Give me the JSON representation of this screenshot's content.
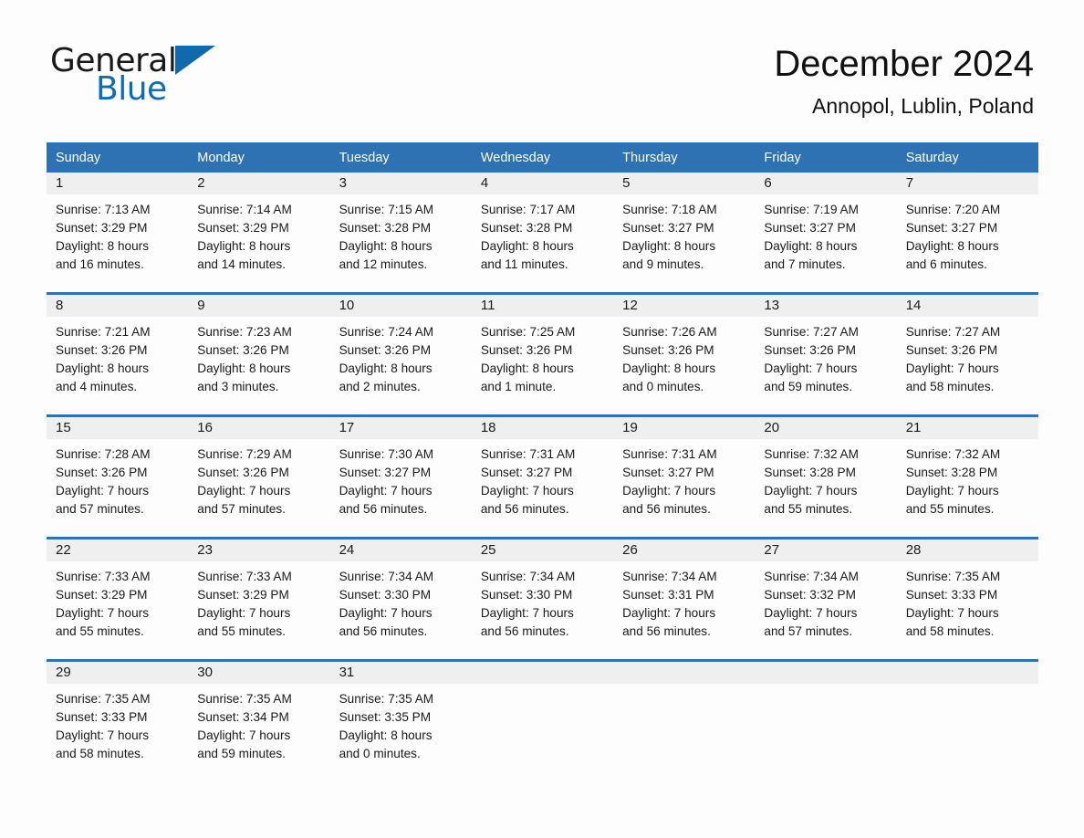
{
  "brand": {
    "word1": "General",
    "word2": "Blue",
    "triangle_color": "#1168ab",
    "blue_color": "#0e6cb6"
  },
  "header": {
    "title": "December 2024",
    "subtitle": "Annopol, Lublin, Poland"
  },
  "theme": {
    "header_blue": "#2f72b4",
    "day_band_gray": "#efefef",
    "page_bg": "#fdfdfd",
    "text": "#1a1a1a"
  },
  "weekday_headers": [
    "Sunday",
    "Monday",
    "Tuesday",
    "Wednesday",
    "Thursday",
    "Friday",
    "Saturday"
  ],
  "chart_data": {
    "type": "table",
    "title": "December 2024 Sunrise and Sunset — Annopol, Lublin, Poland",
    "columns": [
      "Sunday",
      "Monday",
      "Tuesday",
      "Wednesday",
      "Thursday",
      "Friday",
      "Saturday"
    ],
    "fields": [
      "day",
      "sunrise",
      "sunset",
      "daylight_hours",
      "daylight_minutes"
    ]
  },
  "weeks": [
    {
      "cells": [
        {
          "day": "1",
          "l1": "Sunrise: 7:13 AM",
          "l2": "Sunset: 3:29 PM",
          "l3": "Daylight: 8 hours",
          "l4": "and 16 minutes."
        },
        {
          "day": "2",
          "l1": "Sunrise: 7:14 AM",
          "l2": "Sunset: 3:29 PM",
          "l3": "Daylight: 8 hours",
          "l4": "and 14 minutes."
        },
        {
          "day": "3",
          "l1": "Sunrise: 7:15 AM",
          "l2": "Sunset: 3:28 PM",
          "l3": "Daylight: 8 hours",
          "l4": "and 12 minutes."
        },
        {
          "day": "4",
          "l1": "Sunrise: 7:17 AM",
          "l2": "Sunset: 3:28 PM",
          "l3": "Daylight: 8 hours",
          "l4": "and 11 minutes."
        },
        {
          "day": "5",
          "l1": "Sunrise: 7:18 AM",
          "l2": "Sunset: 3:27 PM",
          "l3": "Daylight: 8 hours",
          "l4": "and 9 minutes."
        },
        {
          "day": "6",
          "l1": "Sunrise: 7:19 AM",
          "l2": "Sunset: 3:27 PM",
          "l3": "Daylight: 8 hours",
          "l4": "and 7 minutes."
        },
        {
          "day": "7",
          "l1": "Sunrise: 7:20 AM",
          "l2": "Sunset: 3:27 PM",
          "l3": "Daylight: 8 hours",
          "l4": "and 6 minutes."
        }
      ]
    },
    {
      "cells": [
        {
          "day": "8",
          "l1": "Sunrise: 7:21 AM",
          "l2": "Sunset: 3:26 PM",
          "l3": "Daylight: 8 hours",
          "l4": "and 4 minutes."
        },
        {
          "day": "9",
          "l1": "Sunrise: 7:23 AM",
          "l2": "Sunset: 3:26 PM",
          "l3": "Daylight: 8 hours",
          "l4": "and 3 minutes."
        },
        {
          "day": "10",
          "l1": "Sunrise: 7:24 AM",
          "l2": "Sunset: 3:26 PM",
          "l3": "Daylight: 8 hours",
          "l4": "and 2 minutes."
        },
        {
          "day": "11",
          "l1": "Sunrise: 7:25 AM",
          "l2": "Sunset: 3:26 PM",
          "l3": "Daylight: 8 hours",
          "l4": "and 1 minute."
        },
        {
          "day": "12",
          "l1": "Sunrise: 7:26 AM",
          "l2": "Sunset: 3:26 PM",
          "l3": "Daylight: 8 hours",
          "l4": "and 0 minutes."
        },
        {
          "day": "13",
          "l1": "Sunrise: 7:27 AM",
          "l2": "Sunset: 3:26 PM",
          "l3": "Daylight: 7 hours",
          "l4": "and 59 minutes."
        },
        {
          "day": "14",
          "l1": "Sunrise: 7:27 AM",
          "l2": "Sunset: 3:26 PM",
          "l3": "Daylight: 7 hours",
          "l4": "and 58 minutes."
        }
      ]
    },
    {
      "cells": [
        {
          "day": "15",
          "l1": "Sunrise: 7:28 AM",
          "l2": "Sunset: 3:26 PM",
          "l3": "Daylight: 7 hours",
          "l4": "and 57 minutes."
        },
        {
          "day": "16",
          "l1": "Sunrise: 7:29 AM",
          "l2": "Sunset: 3:26 PM",
          "l3": "Daylight: 7 hours",
          "l4": "and 57 minutes."
        },
        {
          "day": "17",
          "l1": "Sunrise: 7:30 AM",
          "l2": "Sunset: 3:27 PM",
          "l3": "Daylight: 7 hours",
          "l4": "and 56 minutes."
        },
        {
          "day": "18",
          "l1": "Sunrise: 7:31 AM",
          "l2": "Sunset: 3:27 PM",
          "l3": "Daylight: 7 hours",
          "l4": "and 56 minutes."
        },
        {
          "day": "19",
          "l1": "Sunrise: 7:31 AM",
          "l2": "Sunset: 3:27 PM",
          "l3": "Daylight: 7 hours",
          "l4": "and 56 minutes."
        },
        {
          "day": "20",
          "l1": "Sunrise: 7:32 AM",
          "l2": "Sunset: 3:28 PM",
          "l3": "Daylight: 7 hours",
          "l4": "and 55 minutes."
        },
        {
          "day": "21",
          "l1": "Sunrise: 7:32 AM",
          "l2": "Sunset: 3:28 PM",
          "l3": "Daylight: 7 hours",
          "l4": "and 55 minutes."
        }
      ]
    },
    {
      "cells": [
        {
          "day": "22",
          "l1": "Sunrise: 7:33 AM",
          "l2": "Sunset: 3:29 PM",
          "l3": "Daylight: 7 hours",
          "l4": "and 55 minutes."
        },
        {
          "day": "23",
          "l1": "Sunrise: 7:33 AM",
          "l2": "Sunset: 3:29 PM",
          "l3": "Daylight: 7 hours",
          "l4": "and 55 minutes."
        },
        {
          "day": "24",
          "l1": "Sunrise: 7:34 AM",
          "l2": "Sunset: 3:30 PM",
          "l3": "Daylight: 7 hours",
          "l4": "and 56 minutes."
        },
        {
          "day": "25",
          "l1": "Sunrise: 7:34 AM",
          "l2": "Sunset: 3:30 PM",
          "l3": "Daylight: 7 hours",
          "l4": "and 56 minutes."
        },
        {
          "day": "26",
          "l1": "Sunrise: 7:34 AM",
          "l2": "Sunset: 3:31 PM",
          "l3": "Daylight: 7 hours",
          "l4": "and 56 minutes."
        },
        {
          "day": "27",
          "l1": "Sunrise: 7:34 AM",
          "l2": "Sunset: 3:32 PM",
          "l3": "Daylight: 7 hours",
          "l4": "and 57 minutes."
        },
        {
          "day": "28",
          "l1": "Sunrise: 7:35 AM",
          "l2": "Sunset: 3:33 PM",
          "l3": "Daylight: 7 hours",
          "l4": "and 58 minutes."
        }
      ]
    },
    {
      "cells": [
        {
          "day": "29",
          "l1": "Sunrise: 7:35 AM",
          "l2": "Sunset: 3:33 PM",
          "l3": "Daylight: 7 hours",
          "l4": "and 58 minutes."
        },
        {
          "day": "30",
          "l1": "Sunrise: 7:35 AM",
          "l2": "Sunset: 3:34 PM",
          "l3": "Daylight: 7 hours",
          "l4": "and 59 minutes."
        },
        {
          "day": "31",
          "l1": "Sunrise: 7:35 AM",
          "l2": "Sunset: 3:35 PM",
          "l3": "Daylight: 8 hours",
          "l4": "and 0 minutes."
        },
        {
          "day": "",
          "l1": "",
          "l2": "",
          "l3": "",
          "l4": ""
        },
        {
          "day": "",
          "l1": "",
          "l2": "",
          "l3": "",
          "l4": ""
        },
        {
          "day": "",
          "l1": "",
          "l2": "",
          "l3": "",
          "l4": ""
        },
        {
          "day": "",
          "l1": "",
          "l2": "",
          "l3": "",
          "l4": ""
        }
      ]
    }
  ]
}
